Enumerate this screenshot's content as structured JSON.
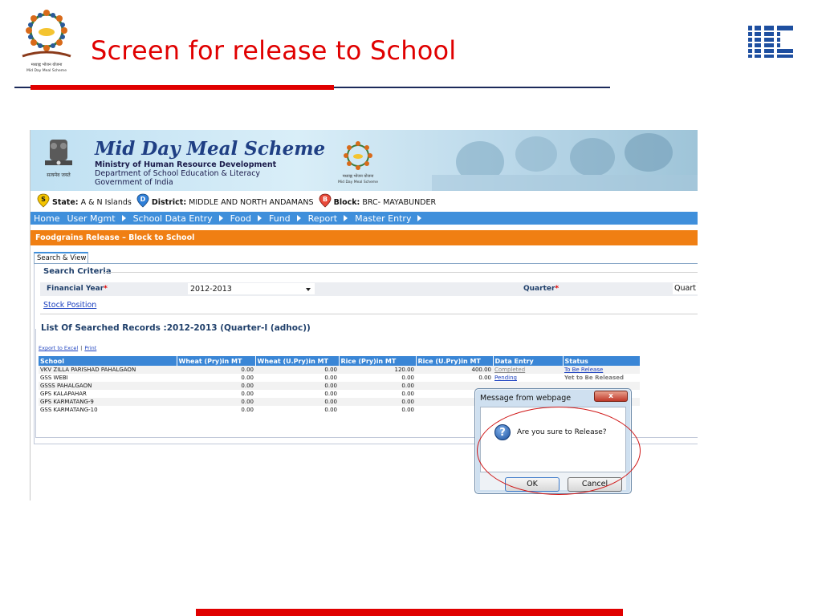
{
  "slide": {
    "title": "Screen for release to School",
    "logo_caption": "मध्याह्न भोजन योजना",
    "logo_caption_en": "Mid Day Meal Scheme",
    "accent_red": "#e00000",
    "rule_dark": "#1c2a5a"
  },
  "banner": {
    "title": "Mid Day Meal Scheme",
    "line1": "Ministry of Human Resource Development",
    "line2": "Department of School Education & Literacy",
    "line3": "Government of India",
    "emblem_caption": "सत्यमेव जयते",
    "center_logo_caption": "मध्याह्न भोजन योजना",
    "center_logo_caption_en": "Mid Day Meal Scheme"
  },
  "info_bar": {
    "state_icon": "S",
    "state_label": "State:",
    "state_value": "A & N Islands",
    "district_icon": "D",
    "district_label": "District:",
    "district_value": "MIDDLE AND NORTH ANDAMANS",
    "block_icon": "B",
    "block_label": "Block:",
    "block_value": "BRC- MAYABUNDER"
  },
  "menu": {
    "items": [
      "Home",
      "User Mgmt",
      "School Data Entry",
      "Food",
      "Fund",
      "Report",
      "Master Entry"
    ],
    "color": "#3f8fdb"
  },
  "page": {
    "section_title": "Foodgrains Release – Block to School",
    "section_color": "#f07f13",
    "tab_label": "Search & View"
  },
  "search": {
    "heading": "Search Criteria",
    "financial_year_label": "Financial Year",
    "financial_year_value": "2012-2013",
    "quarter_label": "Quarter",
    "quarter_value": "Quart",
    "required_mark": "*",
    "stock_link": "Stock Position"
  },
  "records": {
    "title": "List Of Searched Records :2012-2013 (Quarter-I (adhoc))",
    "export_excel": "Export to Excel",
    "print": "Print",
    "columns": [
      "School",
      "Wheat (Pry)in MT",
      "Wheat (U.Pry)in MT",
      "Rice (Pry)in MT",
      "Rice (U.Pry)in MT",
      "Data Entry",
      "Status"
    ],
    "rows": [
      {
        "school": "VKV ZILLA PARISHAD PAHALGAON",
        "wheat_pry": "0.00",
        "wheat_upry": "0.00",
        "rice_pry": "120.00",
        "rice_upry": "400.00",
        "data_entry": "Completed",
        "status": "To Be Release"
      },
      {
        "school": "GSS WEBI",
        "wheat_pry": "0.00",
        "wheat_upry": "0.00",
        "rice_pry": "0.00",
        "rice_upry": "0.00",
        "data_entry": "Pending",
        "status": "Yet to Be Released"
      },
      {
        "school": "GSSS PAHALGAON",
        "wheat_pry": "0.00",
        "wheat_upry": "0.00",
        "rice_pry": "0.00",
        "rice_upry": "",
        "data_entry": "",
        "status": ""
      },
      {
        "school": "GPS KALAPAHAR",
        "wheat_pry": "0.00",
        "wheat_upry": "0.00",
        "rice_pry": "0.00",
        "rice_upry": "",
        "data_entry": "",
        "status": ""
      },
      {
        "school": "GPS KARMATANG-9",
        "wheat_pry": "0.00",
        "wheat_upry": "0.00",
        "rice_pry": "0.00",
        "rice_upry": "",
        "data_entry": "",
        "status": ""
      },
      {
        "school": "GSS KARMATANG-10",
        "wheat_pry": "0.00",
        "wheat_upry": "0.00",
        "rice_pry": "0.00",
        "rice_upry": "",
        "data_entry": "",
        "status": ""
      }
    ]
  },
  "dialog": {
    "title": "Message from webpage",
    "close": "x",
    "message": "Are you sure to Release?",
    "icon": "?",
    "ok_label": "OK",
    "cancel_label": "Cancel"
  }
}
